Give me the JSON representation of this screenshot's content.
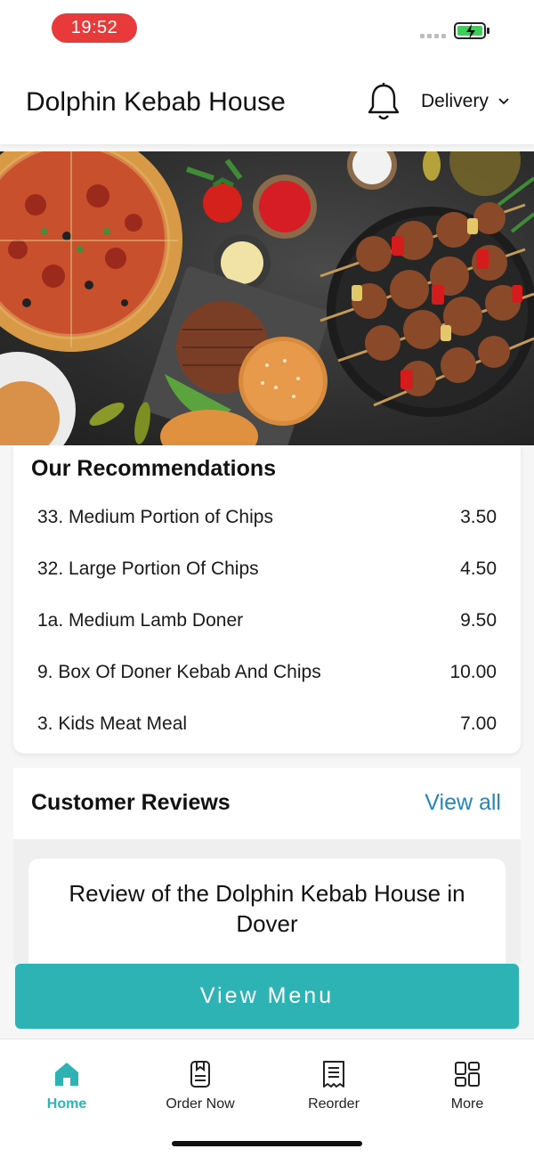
{
  "status_bar": {
    "time": "19:52"
  },
  "header": {
    "title": "Dolphin Kebab House",
    "mode": "Delivery"
  },
  "recommendations": {
    "title": "Our Recommendations",
    "items": [
      {
        "name": "33. Medium Portion of Chips",
        "price": "3.50"
      },
      {
        "name": "32. Large Portion Of Chips",
        "price": "4.50"
      },
      {
        "name": "1a. Medium Lamb Doner",
        "price": "9.50"
      },
      {
        "name": "9. Box Of Doner Kebab And Chips",
        "price": "10.00"
      },
      {
        "name": "3. Kids Meat Meal",
        "price": "7.00"
      }
    ]
  },
  "reviews": {
    "title": "Customer Reviews",
    "view_all": "View all",
    "card_title": "Review of the Dolphin Kebab House in Dover"
  },
  "cta": {
    "label": "View Menu"
  },
  "tabs": [
    {
      "label": "Home",
      "icon": "home-icon"
    },
    {
      "label": "Order Now",
      "icon": "order-icon"
    },
    {
      "label": "Reorder",
      "icon": "receipt-icon"
    },
    {
      "label": "More",
      "icon": "grid-icon"
    }
  ],
  "colors": {
    "accent": "#2db3b3",
    "link": "#2387b8",
    "time_pill": "#e8393b"
  }
}
